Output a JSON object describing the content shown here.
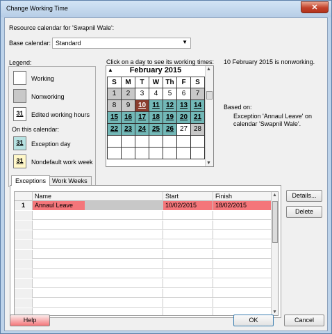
{
  "window": {
    "title": "Change Working Time",
    "close_label": "✕"
  },
  "resource_line": "Resource calendar for 'Swapnil Wale':",
  "base_calendar": {
    "label": "Base calendar:",
    "value": "Standard"
  },
  "legend": {
    "title": "Legend:",
    "items": [
      {
        "label": "Working",
        "swatch": ""
      },
      {
        "label": "Nonworking",
        "swatch": ""
      },
      {
        "label": "Edited working hours",
        "swatch": "31"
      }
    ],
    "on_calendar_title": "On this calendar:",
    "on_calendar_items": [
      {
        "label": "Exception day",
        "swatch": "31"
      },
      {
        "label": "Nondefault work week",
        "swatch": "31"
      }
    ]
  },
  "calendar": {
    "instruction": "Click on a day to see its working times:",
    "month": "February 2015",
    "weekdays": [
      "S",
      "M",
      "T",
      "W",
      "Th",
      "F",
      "S"
    ],
    "weeks": [
      [
        {
          "d": "1",
          "t": "non"
        },
        {
          "d": "2",
          "t": "non"
        },
        {
          "d": "3",
          "t": "work"
        },
        {
          "d": "4",
          "t": "work"
        },
        {
          "d": "5",
          "t": "work"
        },
        {
          "d": "6",
          "t": "work"
        },
        {
          "d": "7",
          "t": "non"
        }
      ],
      [
        {
          "d": "8",
          "t": "non"
        },
        {
          "d": "9",
          "t": "non"
        },
        {
          "d": "10",
          "t": "sel"
        },
        {
          "d": "11",
          "t": "exc"
        },
        {
          "d": "12",
          "t": "exc"
        },
        {
          "d": "13",
          "t": "exc"
        },
        {
          "d": "14",
          "t": "exc"
        }
      ],
      [
        {
          "d": "15",
          "t": "exc"
        },
        {
          "d": "16",
          "t": "exc"
        },
        {
          "d": "17",
          "t": "exc"
        },
        {
          "d": "18",
          "t": "exc"
        },
        {
          "d": "19",
          "t": "exc"
        },
        {
          "d": "20",
          "t": "exc"
        },
        {
          "d": "21",
          "t": "exc"
        }
      ],
      [
        {
          "d": "22",
          "t": "exc"
        },
        {
          "d": "23",
          "t": "exc"
        },
        {
          "d": "24",
          "t": "exc"
        },
        {
          "d": "25",
          "t": "exc"
        },
        {
          "d": "26",
          "t": "exc"
        },
        {
          "d": "27",
          "t": "work"
        },
        {
          "d": "28",
          "t": "non"
        }
      ],
      [
        {
          "d": "",
          "t": "empty"
        },
        {
          "d": "",
          "t": "empty"
        },
        {
          "d": "",
          "t": "empty"
        },
        {
          "d": "",
          "t": "empty"
        },
        {
          "d": "",
          "t": "empty"
        },
        {
          "d": "",
          "t": "empty"
        },
        {
          "d": "",
          "t": "empty"
        }
      ],
      [
        {
          "d": "",
          "t": "empty"
        },
        {
          "d": "",
          "t": "empty"
        },
        {
          "d": "",
          "t": "empty"
        },
        {
          "d": "",
          "t": "empty"
        },
        {
          "d": "",
          "t": "empty"
        },
        {
          "d": "",
          "t": "empty"
        },
        {
          "d": "",
          "t": "empty"
        }
      ]
    ]
  },
  "status": {
    "day_status": "10 February 2015 is nonworking.",
    "based_on_label": "Based on:",
    "based_on_line1": "Exception 'Annaul Leave' on",
    "based_on_line2": "calendar 'Swapnil Wale'."
  },
  "tabs": [
    {
      "label": "Exceptions",
      "active": true
    },
    {
      "label": "Work Weeks",
      "active": false
    }
  ],
  "exceptions_table": {
    "headers": [
      "",
      "Name",
      "Start",
      "Finish"
    ],
    "rows": [
      {
        "num": "1",
        "name": "Annaul Leave",
        "start": "10/02/2015",
        "finish": "18/02/2015"
      }
    ]
  },
  "buttons": {
    "details": "Details...",
    "delete": "Delete",
    "help": "Help",
    "ok": "OK",
    "cancel": "Cancel"
  },
  "colors": {
    "highlight": "#f4767a",
    "exception_day": "#72b8b7",
    "selected_day": "#8b3c2e",
    "nonworking_day": "#c8c8c8"
  }
}
